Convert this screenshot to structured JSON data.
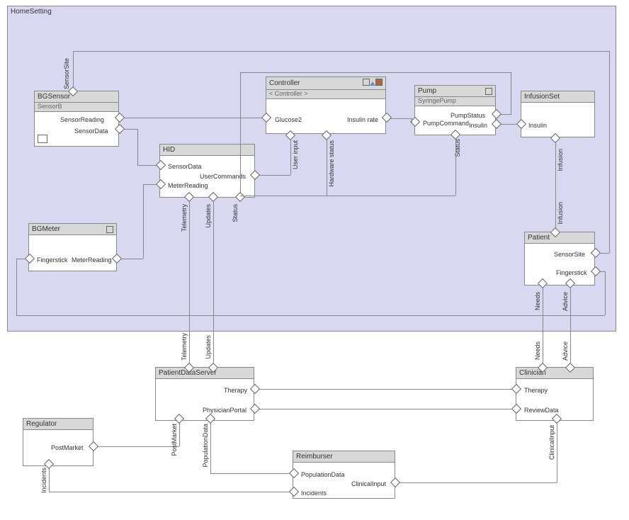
{
  "home_setting": {
    "title": "HomeSetting"
  },
  "bgsensor": {
    "title": "BGSensor",
    "subtitle": "SensorB",
    "ports": {
      "sensor_site": "SensorSite",
      "sensor_reading": "SensorReading",
      "sensor_data": "SensorData"
    }
  },
  "controller": {
    "title": "Controller",
    "subtitle": "< Controller >",
    "ports": {
      "glucose2": "Glucose2",
      "insulin_rate": "Insulin rate",
      "user_input": "User input",
      "hardware_status": "Hardware status"
    }
  },
  "pump": {
    "title": "Pump",
    "subtitle": "SyringePump",
    "ports": {
      "pump_status": "PumpStatus",
      "pump_command": "PumpCommand",
      "insulin": "Insulin",
      "status": "Status"
    }
  },
  "infusion_set": {
    "title": "InfusionSet",
    "ports": {
      "insulin": "Insulin",
      "infusion": "Infusion"
    }
  },
  "hid": {
    "title": "HID",
    "ports": {
      "sensor_data": "SensorData",
      "user_commands": "UserCommands",
      "meter_reading": "MeterReading",
      "telemetry": "Telemetry",
      "updates": "Updates",
      "status": "Status"
    }
  },
  "bgmeter": {
    "title": "BGMeter",
    "ports": {
      "fingerstick": "Fingerstick",
      "meter_reading": "MeterReading"
    }
  },
  "patient": {
    "title": "Patient",
    "ports": {
      "sensor_site": "SensorSite",
      "fingerstick": "Fingerstick",
      "infusion": "Infusion",
      "needs": "Needs",
      "advice": "Advice"
    }
  },
  "patient_data_server": {
    "title": "PatientDataServer",
    "ports": {
      "therapy": "Therapy",
      "physician_portal": "PhysicianPortal",
      "telemetry": "Telemetry",
      "updates": "Updates",
      "post_market": "PostMarket",
      "population_data": "PopulationData"
    }
  },
  "clinician": {
    "title": "Clinician",
    "ports": {
      "therapy": "Therapy",
      "review_data": "ReviewData",
      "needs": "Needs",
      "advice": "Advice",
      "clinical_input": "ClinicalInput"
    }
  },
  "regulator": {
    "title": "Regulator",
    "ports": {
      "post_market": "PostMarket",
      "incidents": "Incidents"
    }
  },
  "reimburser": {
    "title": "Reimburser",
    "ports": {
      "population_data": "PopulationData",
      "clinical_input": "ClinicalInput",
      "incidents": "Incidents"
    }
  },
  "conn_labels": {
    "sensor_site": "SensorSite",
    "infusion": "Infusion",
    "telemetry": "Telemetry",
    "updates": "Updates",
    "status": "Status",
    "needs": "Needs",
    "advice": "Advice",
    "post_market": "PostMarket",
    "population_data": "PopulationData",
    "clinical_input": "ClinicalInput",
    "incidents": "Incidents",
    "user_input": "User input",
    "hardware_status": "Hardware status"
  }
}
